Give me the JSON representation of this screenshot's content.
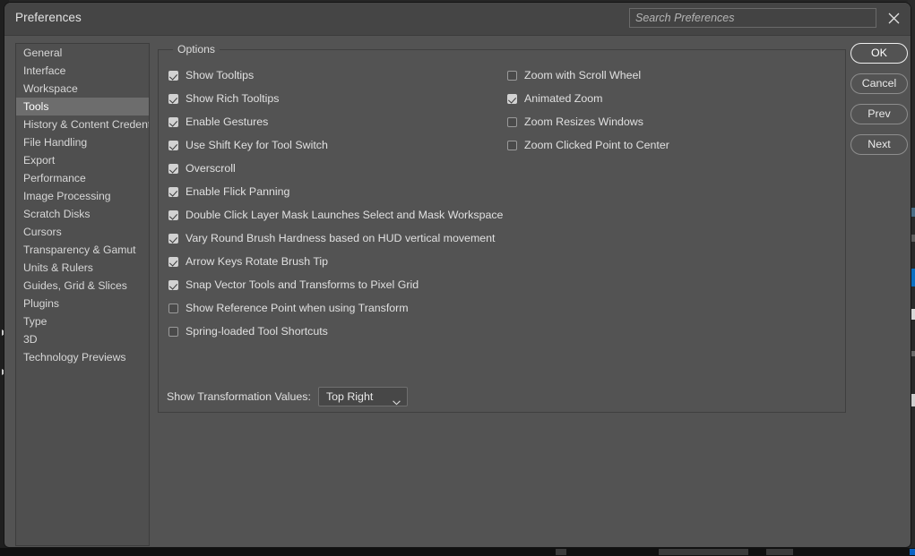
{
  "window": {
    "title": "Preferences",
    "close_icon": "close-icon"
  },
  "search": {
    "placeholder": "Search Preferences",
    "value": ""
  },
  "sidebar": {
    "selected": "Tools",
    "items": [
      {
        "label": "General"
      },
      {
        "label": "Interface"
      },
      {
        "label": "Workspace"
      },
      {
        "label": "Tools"
      },
      {
        "label": "History & Content Credentials"
      },
      {
        "label": "File Handling"
      },
      {
        "label": "Export"
      },
      {
        "label": "Performance"
      },
      {
        "label": "Image Processing"
      },
      {
        "label": "Scratch Disks"
      },
      {
        "label": "Cursors"
      },
      {
        "label": "Transparency & Gamut"
      },
      {
        "label": "Units & Rulers"
      },
      {
        "label": "Guides, Grid & Slices"
      },
      {
        "label": "Plugins"
      },
      {
        "label": "Type"
      },
      {
        "label": "3D"
      },
      {
        "label": "Technology Previews"
      }
    ]
  },
  "options": {
    "legend": "Options",
    "left_column": [
      {
        "label": "Show Tooltips",
        "checked": true
      },
      {
        "label": "Show Rich Tooltips",
        "checked": true
      },
      {
        "label": "Enable Gestures",
        "checked": true
      },
      {
        "label": "Use Shift Key for Tool Switch",
        "checked": true
      },
      {
        "label": "Overscroll",
        "checked": true
      },
      {
        "label": "Enable Flick Panning",
        "checked": true
      },
      {
        "label": "Double Click Layer Mask Launches Select and Mask Workspace",
        "checked": true
      },
      {
        "label": "Vary Round Brush Hardness based on HUD vertical movement",
        "checked": true
      },
      {
        "label": "Arrow Keys Rotate Brush Tip",
        "checked": true
      },
      {
        "label": "Snap Vector Tools and Transforms to Pixel Grid",
        "checked": true
      },
      {
        "label": "Show Reference Point when using Transform",
        "checked": false
      },
      {
        "label": "Spring-loaded Tool Shortcuts",
        "checked": false
      }
    ],
    "right_column": [
      {
        "label": "Zoom with Scroll Wheel",
        "checked": false
      },
      {
        "label": "Animated Zoom",
        "checked": true
      },
      {
        "label": "Zoom Resizes Windows",
        "checked": false
      },
      {
        "label": "Zoom Clicked Point to Center",
        "checked": false
      }
    ],
    "transform": {
      "label": "Show Transformation Values:",
      "value": "Top Right",
      "chevron_icon": "chevron-down-icon"
    }
  },
  "buttons": [
    {
      "label": "OK",
      "primary": true
    },
    {
      "label": "Cancel",
      "primary": false
    },
    {
      "label": "Prev",
      "primary": false
    },
    {
      "label": "Next",
      "primary": false
    }
  ],
  "colors": {
    "dialog_bg": "#535353",
    "titlebar_bg": "#454545",
    "sidebar_bg": "#4f4f4f",
    "selection_bg": "#6d6d6d",
    "text": "#e0e0e0",
    "accent_border": "#f0f0f0"
  }
}
